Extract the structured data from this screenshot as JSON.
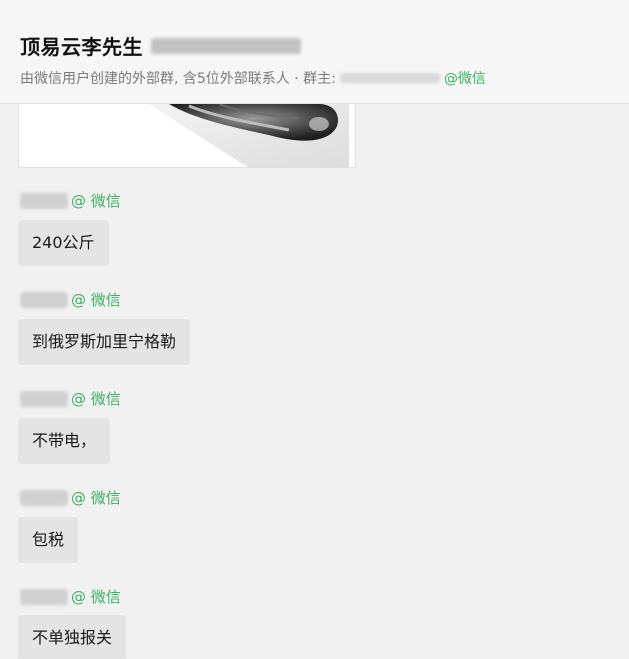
{
  "header": {
    "title": "顶易云李先生",
    "subtitle_prefix": "由微信用户创建的外部群, 含5位外部联系人 · 群主:",
    "subtitle_suffix": "@微信"
  },
  "messages": [
    {
      "sender_suffix": "@ 微信",
      "text": "240公斤"
    },
    {
      "sender_suffix": "@ 微信",
      "text": "到俄罗斯加里宁格勒"
    },
    {
      "sender_suffix": "@ 微信",
      "text": "不带电，"
    },
    {
      "sender_suffix": "@ 微信",
      "text": "包税"
    },
    {
      "sender_suffix": "@ 微信",
      "text": "不单独报关"
    }
  ],
  "colors": {
    "accent_green": "#3faf63",
    "bubble": "#e4e4e4",
    "background": "#f1f1f1"
  }
}
